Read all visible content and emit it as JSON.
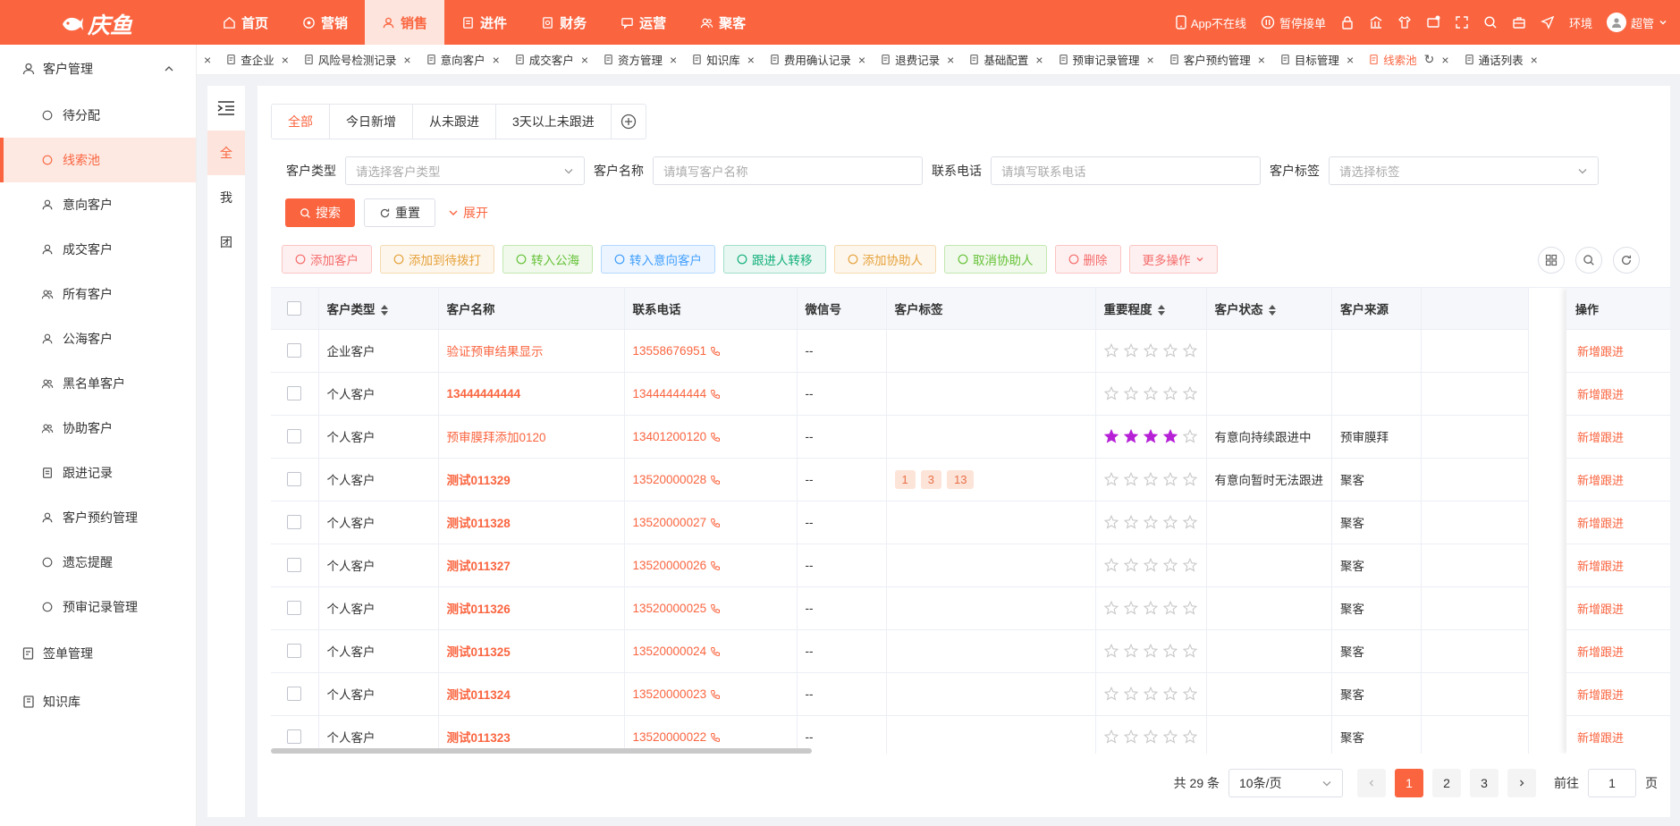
{
  "brand": {
    "name": "庆鱼"
  },
  "topnav": [
    {
      "label": "首页",
      "icon": "home-icon"
    },
    {
      "label": "营销",
      "icon": "target-icon"
    },
    {
      "label": "销售",
      "icon": "user-icon",
      "active": true
    },
    {
      "label": "进件",
      "icon": "file-icon"
    },
    {
      "label": "财务",
      "icon": "finance-icon"
    },
    {
      "label": "运营",
      "icon": "chat-icon"
    },
    {
      "label": "聚客",
      "icon": "group-icon"
    }
  ],
  "topright": {
    "app_status": "App不在线",
    "pause": "暂停接单",
    "env": "环境",
    "user": "超管"
  },
  "sidebar": {
    "group1": "客户管理",
    "items": [
      "待分配",
      "线索池",
      "意向客户",
      "成交客户",
      "所有客户",
      "公海客户",
      "黑名单客户",
      "协助客户",
      "跟进记录",
      "客户预约管理",
      "遗忘提醒",
      "预审记录管理"
    ],
    "active_index": 1,
    "group2": "签单管理",
    "group3": "知识库"
  },
  "tabs": [
    {
      "label": "查企业"
    },
    {
      "label": "风险号检测记录"
    },
    {
      "label": "意向客户"
    },
    {
      "label": "成交客户"
    },
    {
      "label": "资方管理"
    },
    {
      "label": "知识库"
    },
    {
      "label": "费用确认记录"
    },
    {
      "label": "退费记录"
    },
    {
      "label": "基础配置"
    },
    {
      "label": "预审记录管理"
    },
    {
      "label": "客户预约管理"
    },
    {
      "label": "目标管理"
    },
    {
      "label": "线索池",
      "active": true
    },
    {
      "label": "通话列表"
    }
  ],
  "leftcol": [
    "全",
    "我",
    "团"
  ],
  "filter_tabs": [
    "全部",
    "今日新增",
    "从未跟进",
    "3天以上未跟进"
  ],
  "filters": {
    "type_label": "客户类型",
    "type_ph": "请选择客户类型",
    "name_label": "客户名称",
    "name_ph": "请填写客户名称",
    "phone_label": "联系电话",
    "phone_ph": "请填写联系电话",
    "tag_label": "客户标签",
    "tag_ph": "请选择标签"
  },
  "buttons": {
    "search": "搜索",
    "reset": "重置",
    "expand": "展开"
  },
  "actions": [
    {
      "label": "添加客户",
      "color": "#f56c6c",
      "bg": "#fef0f0"
    },
    {
      "label": "添加到待拨打",
      "color": "#e6a23c",
      "bg": "#fdf6ec"
    },
    {
      "label": "转入公海",
      "color": "#67c23a",
      "bg": "#f0f9eb"
    },
    {
      "label": "转入意向客户",
      "color": "#409eff",
      "bg": "#ecf5ff"
    },
    {
      "label": "跟进人转移",
      "color": "#13b07a",
      "bg": "#e8f7f1"
    },
    {
      "label": "添加协助人",
      "color": "#e6a23c",
      "bg": "#fdf6ec"
    },
    {
      "label": "取消协助人",
      "color": "#67c23a",
      "bg": "#f0f9eb"
    },
    {
      "label": "删除",
      "color": "#f56c6c",
      "bg": "#fef0f0"
    },
    {
      "label": "更多操作",
      "color": "#f56c6c",
      "bg": "#fef0f0"
    }
  ],
  "table": {
    "headers": [
      "客户类型",
      "客户名称",
      "联系电话",
      "微信号",
      "客户标签",
      "重要程度",
      "客户状态",
      "客户来源",
      "操作"
    ],
    "op_label": "新增跟进",
    "rows": [
      {
        "type": "企业客户",
        "name": "验证预审结果显示",
        "name_bold": false,
        "phone": "13558676951",
        "wechat": "--",
        "tags": [],
        "stars": 0,
        "status": "",
        "source": ""
      },
      {
        "type": "个人客户",
        "name": "13444444444",
        "name_bold": true,
        "phone": "13444444444",
        "wechat": "--",
        "tags": [],
        "stars": 0,
        "status": "",
        "source": ""
      },
      {
        "type": "个人客户",
        "name": "预审膜拜添加0120",
        "name_bold": false,
        "phone": "13401200120",
        "wechat": "--",
        "tags": [],
        "stars": 4,
        "status": "有意向持续跟进中",
        "source": "预审膜拜"
      },
      {
        "type": "个人客户",
        "name": "测试011329",
        "name_bold": true,
        "phone": "13520000028",
        "wechat": "--",
        "tags": [
          "1",
          "3",
          "13"
        ],
        "stars": 0,
        "status": "有意向暂时无法跟进",
        "source": "聚客"
      },
      {
        "type": "个人客户",
        "name": "测试011328",
        "name_bold": true,
        "phone": "13520000027",
        "wechat": "--",
        "tags": [],
        "stars": 0,
        "status": "",
        "source": "聚客"
      },
      {
        "type": "个人客户",
        "name": "测试011327",
        "name_bold": true,
        "phone": "13520000026",
        "wechat": "--",
        "tags": [],
        "stars": 0,
        "status": "",
        "source": "聚客"
      },
      {
        "type": "个人客户",
        "name": "测试011326",
        "name_bold": true,
        "phone": "13520000025",
        "wechat": "--",
        "tags": [],
        "stars": 0,
        "status": "",
        "source": "聚客"
      },
      {
        "type": "个人客户",
        "name": "测试011325",
        "name_bold": true,
        "phone": "13520000024",
        "wechat": "--",
        "tags": [],
        "stars": 0,
        "status": "",
        "source": "聚客"
      },
      {
        "type": "个人客户",
        "name": "测试011324",
        "name_bold": true,
        "phone": "13520000023",
        "wechat": "--",
        "tags": [],
        "stars": 0,
        "status": "",
        "source": "聚客"
      },
      {
        "type": "个人客户",
        "name": "测试011323",
        "name_bold": true,
        "phone": "13520000022",
        "wechat": "--",
        "tags": [],
        "stars": 0,
        "status": "",
        "source": "聚客"
      }
    ]
  },
  "pager": {
    "total": "共 29 条",
    "size": "10条/页",
    "pages": [
      "1",
      "2",
      "3"
    ],
    "current": "1",
    "goto": "前往",
    "goto_val": "1",
    "page_suffix": "页"
  },
  "colors": {
    "brand": "#fa6540",
    "star_on": "#b621d6",
    "star_off": "#c8c8c8"
  }
}
